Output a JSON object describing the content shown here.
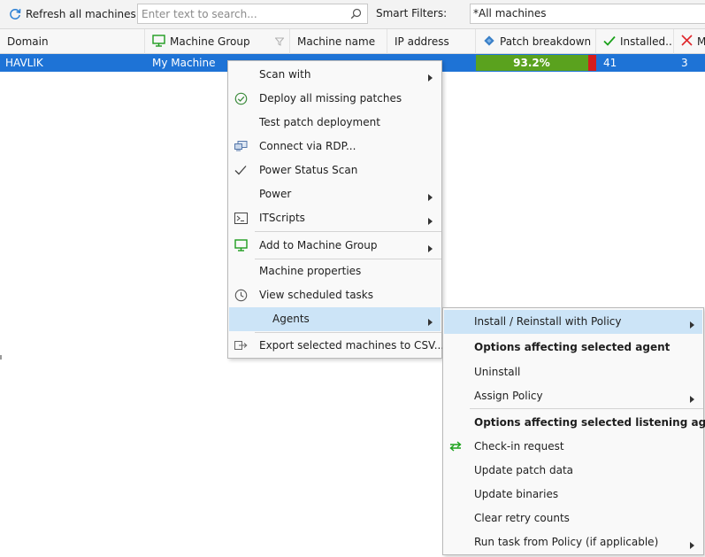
{
  "toolbar": {
    "refresh_label": "Refresh all machines",
    "search_placeholder": "Enter text to search...",
    "search_value": "",
    "smart_filters_label": "Smart Filters:",
    "smart_filters_value": "*All machines"
  },
  "grid": {
    "columns": [
      {
        "label": "Domain",
        "icon": ""
      },
      {
        "label": "Machine Group",
        "icon": "monitor-icon"
      },
      {
        "label": "Machine name",
        "icon": ""
      },
      {
        "label": "IP address",
        "icon": ""
      },
      {
        "label": "Patch breakdown",
        "icon": "diamond-icon"
      },
      {
        "label": "Installed...",
        "icon": "check-icon"
      },
      {
        "label": "M",
        "icon": "x-icon"
      }
    ],
    "rows": [
      {
        "domain": "HAVLIK",
        "machine_group": "My Machine",
        "patch_percent": "93.2%",
        "patch_fraction": 0.932,
        "installed": "41",
        "missing": "3"
      }
    ]
  },
  "context_menu": {
    "items": [
      {
        "label": "Scan with",
        "icon": "",
        "has_submenu": true
      },
      {
        "label": "Deploy all missing patches",
        "icon": "check-circle-icon",
        "has_submenu": false
      },
      {
        "label": "Test patch deployment",
        "icon": "",
        "has_submenu": false
      },
      {
        "label": "Connect via RDP...",
        "icon": "rdp-icon",
        "has_submenu": false
      },
      {
        "label": "Power Status Scan",
        "icon": "checkmark-icon",
        "has_submenu": false
      },
      {
        "label": "Power",
        "icon": "",
        "has_submenu": true
      },
      {
        "label": "ITScripts",
        "icon": "terminal-icon",
        "has_submenu": true
      },
      {
        "label": "Add to Machine Group",
        "icon": "monitor-icon",
        "has_submenu": true
      },
      {
        "label": "Machine properties",
        "icon": "",
        "has_submenu": false
      },
      {
        "label": "View scheduled tasks",
        "icon": "clock-icon",
        "has_submenu": false
      },
      {
        "label": "Agents",
        "icon": "",
        "has_submenu": true,
        "highlighted": true
      },
      {
        "label": "Export selected machines to CSV...",
        "icon": "export-icon",
        "has_submenu": false
      }
    ]
  },
  "agents_submenu": {
    "items": [
      {
        "label": "Install / Reinstall with Policy",
        "has_submenu": true,
        "highlighted": true
      },
      {
        "label": "Options affecting selected agent",
        "bold": true
      },
      {
        "label": "Uninstall"
      },
      {
        "label": "Assign Policy",
        "has_submenu": true
      },
      {
        "label": "Options affecting selected listening agent",
        "bold": true
      },
      {
        "label": "Check-in request",
        "icon": "sync-arrows-icon"
      },
      {
        "label": "Update patch data"
      },
      {
        "label": "Update binaries"
      },
      {
        "label": "Clear retry counts"
      },
      {
        "label": "Run task from Policy (if applicable)",
        "has_submenu": true
      }
    ]
  },
  "colors": {
    "selection_row": "#1e73d6",
    "patch_green": "#5aa21e",
    "patch_red": "#d41d1d",
    "menu_highlight": "#cce4f7",
    "check_green": "#1aa11a",
    "x_red": "#e0262b"
  }
}
